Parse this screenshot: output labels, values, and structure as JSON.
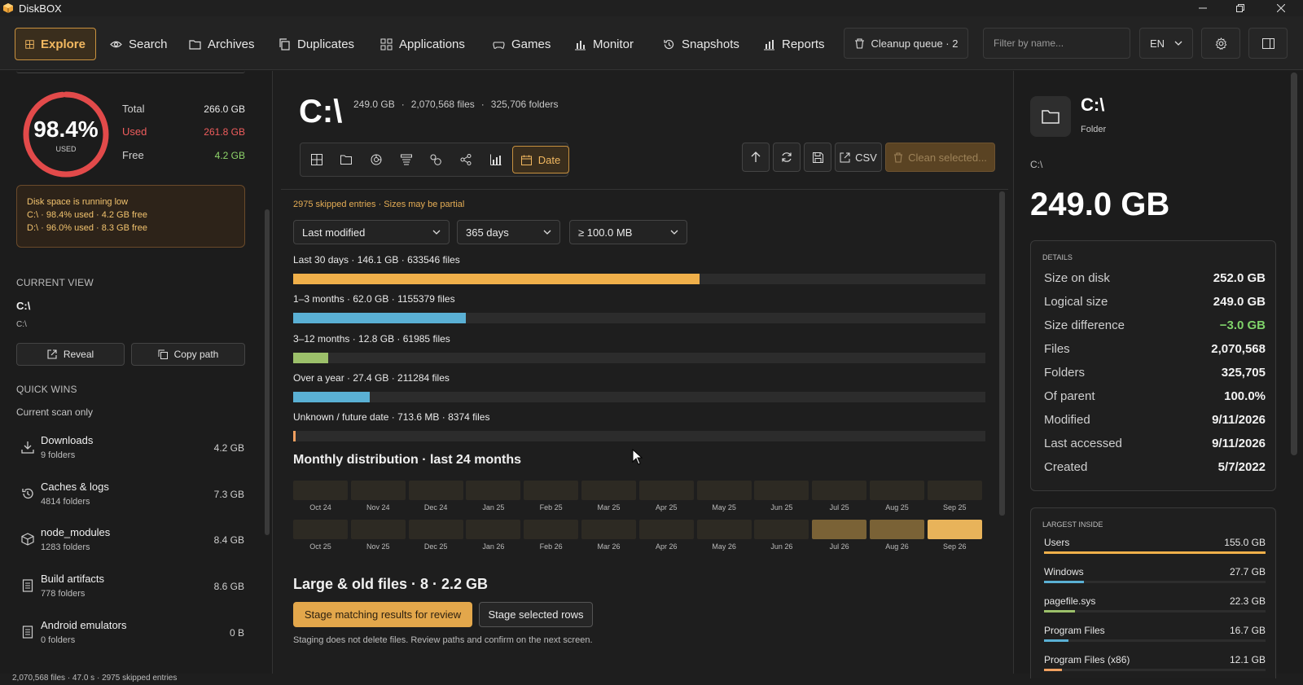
{
  "app": {
    "title": "DiskBOX"
  },
  "nav": {
    "items": [
      {
        "label": "Explore",
        "icon": "grid-icon",
        "active": true
      },
      {
        "label": "Search",
        "icon": "eye-icon"
      },
      {
        "label": "Archives",
        "icon": "folder-icon"
      },
      {
        "label": "Duplicates",
        "icon": "copy-icon"
      },
      {
        "label": "Applications",
        "icon": "apps-icon"
      },
      {
        "label": "Games",
        "icon": "gamepad-icon"
      },
      {
        "label": "Monitor",
        "icon": "bar-chart-icon"
      },
      {
        "label": "Snapshots",
        "icon": "history-icon"
      },
      {
        "label": "Reports",
        "icon": "report-icon"
      }
    ],
    "cleanup_queue": "Cleanup queue · 2",
    "filter_placeholder": "Filter by name...",
    "language": "EN"
  },
  "disk": {
    "percent": "98.4%",
    "percent_label": "USED",
    "used_fraction": 0.984,
    "total_label": "Total",
    "total_value": "266.0 GB",
    "used_label": "Used",
    "used_value": "261.8 GB",
    "free_label": "Free",
    "free_value": "4.2 GB",
    "warning_title": "Disk space is running low",
    "warning_lines": [
      "C:\\ · 98.4% used · 4.2 GB free",
      "D:\\ · 96.0% used · 8.3 GB free"
    ]
  },
  "current_view": {
    "section": "CURRENT VIEW",
    "name": "C:\\",
    "path": "C:\\",
    "reveal": "Reveal",
    "copy_path": "Copy path"
  },
  "quick_wins": {
    "section": "QUICK WINS",
    "subtitle": "Current scan only",
    "items": [
      {
        "name": "Downloads",
        "sub": "9 folders",
        "size": "4.2 GB",
        "icon": "download-icon"
      },
      {
        "name": "Caches & logs",
        "sub": "4814 folders",
        "size": "7.3 GB",
        "icon": "history-icon"
      },
      {
        "name": "node_modules",
        "sub": "1283 folders",
        "size": "8.4 GB",
        "icon": "package-icon"
      },
      {
        "name": "Build artifacts",
        "sub": "778 folders",
        "size": "8.6 GB",
        "icon": "document-icon"
      },
      {
        "name": "Android emulators",
        "sub": "0 folders",
        "size": "0 B",
        "icon": "document-icon"
      }
    ]
  },
  "status_bar": "2,070,568 files · 47.0 s · 2975 skipped entries",
  "center": {
    "title": "C:\\",
    "size": "249.0 GB",
    "files": "2,070,568 files",
    "folders": "325,706 folders",
    "date_tab": "Date",
    "csv": "CSV",
    "clean_selected": "Clean selected...",
    "skipped_note": "2975 skipped entries · Sizes may be partial",
    "filters": [
      "Last modified",
      "365 days",
      "≥ 100.0 MB"
    ],
    "bars": [
      {
        "label": "Last 30 days · 146.1 GB · 633546 files",
        "fraction": 0.587,
        "color": "#f0b04a"
      },
      {
        "label": "1–3 months · 62.0 GB · 1155379 files",
        "fraction": 0.249,
        "color": "#5ab0d4"
      },
      {
        "label": "3–12 months · 12.8 GB · 61985 files",
        "fraction": 0.051,
        "color": "#9cc06a"
      },
      {
        "label": "Over a year · 27.4 GB · 211284 files",
        "fraction": 0.11,
        "color": "#5ab0d4"
      },
      {
        "label": "Unknown / future date · 713.6 MB · 8374 files",
        "fraction": 0.003,
        "color": "#f0a060"
      }
    ],
    "monthly_title": "Monthly distribution · last 24 months",
    "months_row1": [
      "Oct 24",
      "Nov 24",
      "Dec 24",
      "Jan 25",
      "Feb 25",
      "Mar 25",
      "Apr 25",
      "May 25",
      "Jun 25",
      "Jul 25",
      "Aug 25",
      "Sep 25"
    ],
    "months_row2": [
      "Oct 25",
      "Nov 25",
      "Dec 25",
      "Jan 26",
      "Feb 26",
      "Mar 26",
      "Apr 26",
      "May 26",
      "Jun 26",
      "Jul 26",
      "Aug 26",
      "Sep 26"
    ],
    "large_title": "Large & old files · 8 · 2.2 GB",
    "stage_matching": "Stage matching results for review",
    "stage_selected": "Stage selected rows",
    "staging_note": "Staging does not delete files. Review paths and confirm on the next screen."
  },
  "details": {
    "name": "C:\\",
    "type": "Folder",
    "path": "C:\\",
    "size": "249.0 GB",
    "section": "DETAILS",
    "rows": [
      {
        "k": "Size on disk",
        "v": "252.0 GB"
      },
      {
        "k": "Logical size",
        "v": "249.0 GB"
      },
      {
        "k": "Size difference",
        "v": "−3.0 GB",
        "color": "#7fd36a"
      },
      {
        "k": "Files",
        "v": "2,070,568"
      },
      {
        "k": "Folders",
        "v": "325,705"
      },
      {
        "k": "Of parent",
        "v": "100.0%"
      },
      {
        "k": "Modified",
        "v": "9/11/2026"
      },
      {
        "k": "Last accessed",
        "v": "9/11/2026"
      },
      {
        "k": "Created",
        "v": "5/7/2022"
      }
    ],
    "largest_section": "LARGEST INSIDE",
    "largest": [
      {
        "name": "Users",
        "size": "155.0 GB",
        "fraction": 1.0,
        "color": "#f0b04a"
      },
      {
        "name": "Windows",
        "size": "27.7 GB",
        "fraction": 0.18,
        "color": "#5ab0d4"
      },
      {
        "name": "pagefile.sys",
        "size": "22.3 GB",
        "fraction": 0.14,
        "color": "#9cc06a"
      },
      {
        "name": "Program Files",
        "size": "16.7 GB",
        "fraction": 0.11,
        "color": "#5ab0d4"
      },
      {
        "name": "Program Files (x86)",
        "size": "12.1 GB",
        "fraction": 0.08,
        "color": "#f0a060"
      }
    ]
  }
}
